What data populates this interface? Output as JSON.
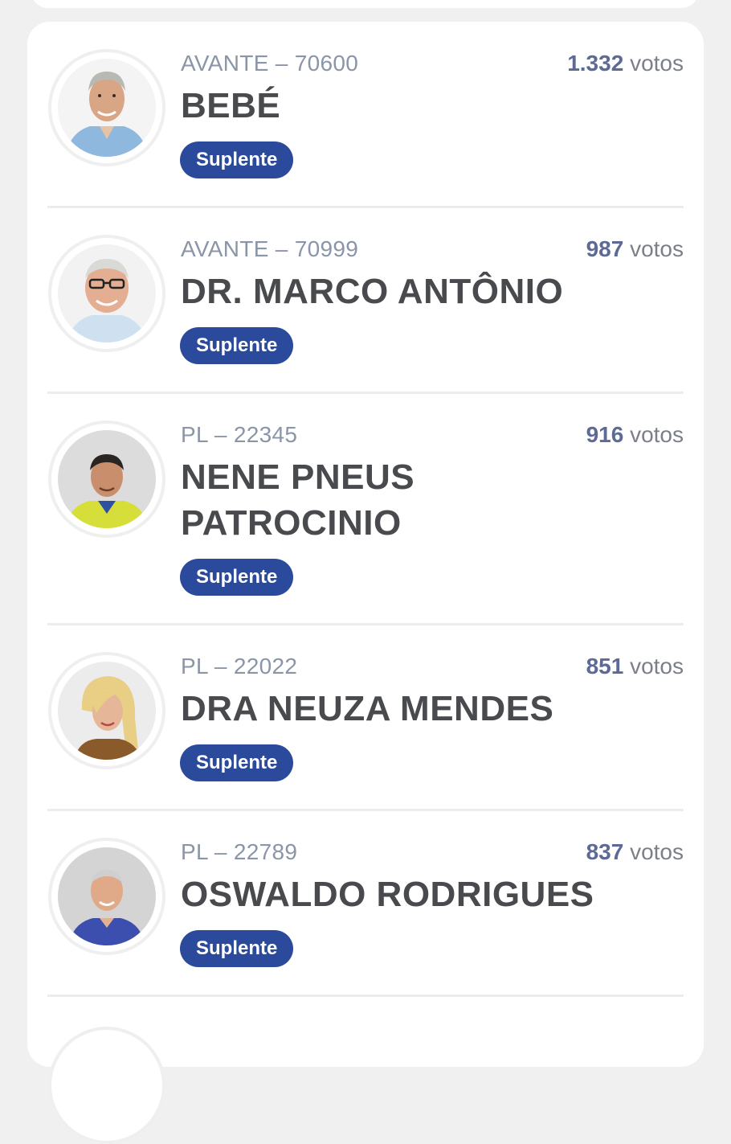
{
  "candidates": [
    {
      "party_number": "AVANTE – 70600",
      "votes_number": "1.332",
      "votes_label": "votos",
      "name": "BEBÉ",
      "status": "Suplente"
    },
    {
      "party_number": "AVANTE – 70999",
      "votes_number": "987",
      "votes_label": "votos",
      "name": "DR. MARCO ANTÔNIO",
      "status": "Suplente"
    },
    {
      "party_number": "PL – 22345",
      "votes_number": "916",
      "votes_label": "votos",
      "name_line1": "NENE PNEUS",
      "name_line2": "PATROCINIO",
      "status": "Suplente"
    },
    {
      "party_number": "PL – 22022",
      "votes_number": "851",
      "votes_label": "votos",
      "name": "DRA NEUZA MENDES",
      "status": "Suplente"
    },
    {
      "party_number": "PL – 22789",
      "votes_number": "837",
      "votes_label": "votos",
      "name": "OSWALDO RODRIGUES",
      "status": "Suplente"
    }
  ],
  "colors": {
    "badge": "#2c4a9c",
    "party_text": "#8a95a7",
    "votes_number": "#5d6a96",
    "name_text": "#484a4d"
  }
}
